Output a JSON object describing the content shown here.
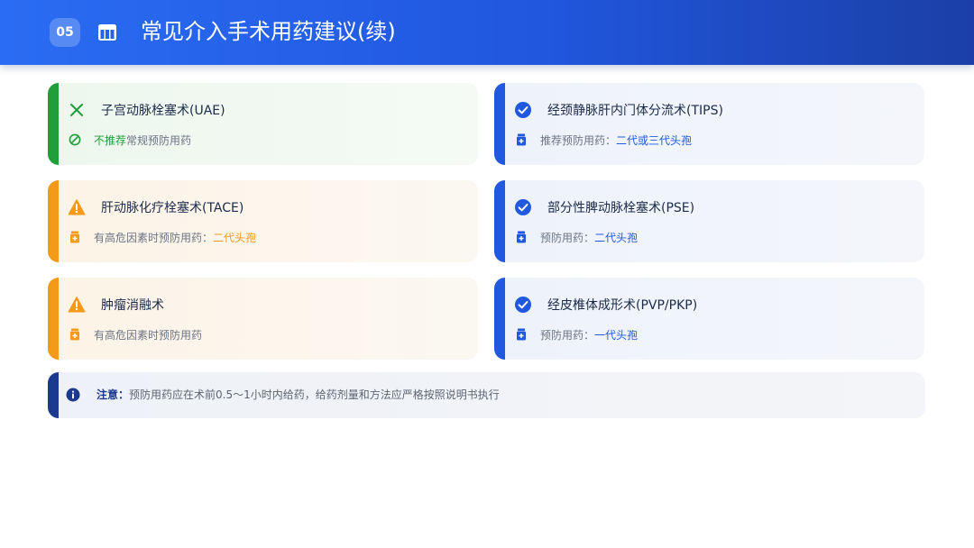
{
  "header": {
    "badge": "05",
    "icon": "table-icon",
    "title": "常见介入手术用药建议(续)"
  },
  "cards": [
    {
      "icon": "x-icon",
      "title": "子宫动脉栓塞术(UAE)",
      "desc_icon": "ban-icon",
      "desc_prefix": "",
      "desc_highlight": "不推荐",
      "desc_suffix": "常规预防用药",
      "color": "#1f9e3a"
    },
    {
      "icon": "check-circle-icon",
      "title": "经颈静脉肝内门体分流术(TIPS)",
      "desc_icon": "pill-bottle-icon",
      "desc_prefix": "推荐预防用药：",
      "desc_highlight": "二代或三代头孢",
      "desc_suffix": "",
      "color": "#2058df"
    },
    {
      "icon": "warning-icon",
      "title": "肝动脉化疗栓塞术(TACE)",
      "desc_icon": "pill-bottle-icon",
      "desc_prefix": "有高危因素时预防用药：",
      "desc_highlight": "二代头孢",
      "desc_suffix": "",
      "color": "#f39a1a"
    },
    {
      "icon": "check-circle-icon",
      "title": "部分性脾动脉栓塞术(PSE)",
      "desc_icon": "pill-bottle-icon",
      "desc_prefix": "预防用药：",
      "desc_highlight": "二代头孢",
      "desc_suffix": "",
      "color": "#2058df"
    },
    {
      "icon": "warning-icon",
      "title": "肿瘤消融术",
      "desc_icon": "pill-bottle-icon",
      "desc_prefix": "有高危因素时预防用药",
      "desc_highlight": "",
      "desc_suffix": "",
      "color": "#f39a1a"
    },
    {
      "icon": "check-circle-icon",
      "title": "经皮椎体成形术(PVP/PKP)",
      "desc_icon": "pill-bottle-icon",
      "desc_prefix": "预防用药：",
      "desc_highlight": "一代头孢",
      "desc_suffix": "",
      "color": "#2058df"
    }
  ],
  "note": {
    "icon": "info-icon",
    "label": "注意：",
    "text": "预防用药应在术前0.5～1小时内给药，给药剂量和方法应严格按照说明书执行"
  }
}
